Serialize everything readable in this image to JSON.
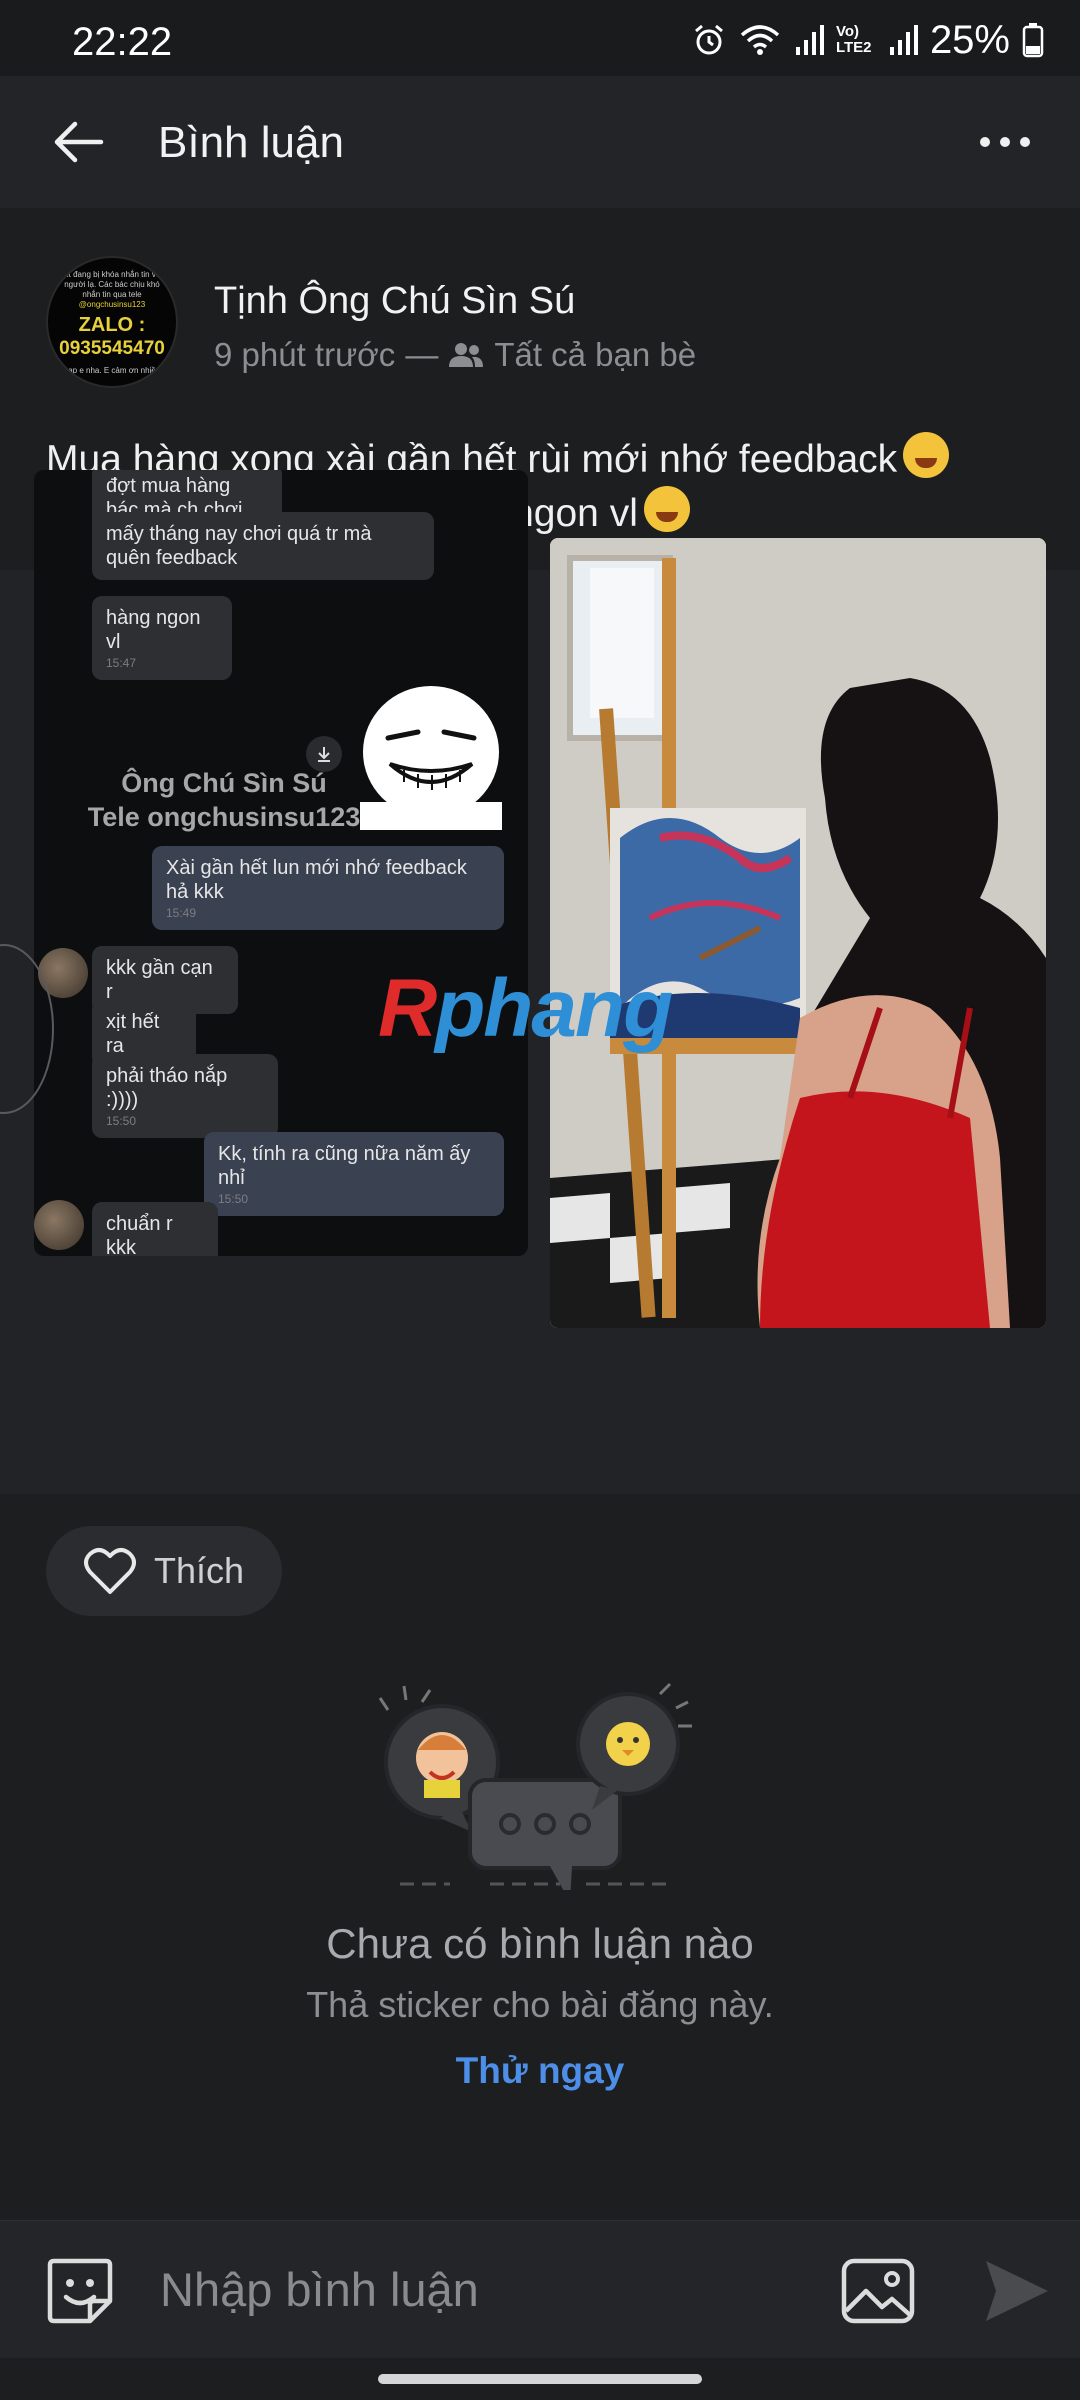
{
  "status_bar": {
    "time": "22:22",
    "network_label": "Vo) LTE2",
    "battery": "25%"
  },
  "app_bar": {
    "title": "Bình luận",
    "back_icon": "arrow-left-icon",
    "more_icon": "more-horizontal-icon"
  },
  "post": {
    "author": "Tịnh Ông Chú Sìn Sú",
    "time_ago": "9 phút trước",
    "separator": "—",
    "privacy": "Tất cả bạn bè",
    "text_line1": "Mua hàng xong xài gần hết rùi mới nhớ feedback",
    "text_line2": "Tóm lại là khách kêu hàng ngon vl",
    "avatar_text": {
      "tiny1": "Nit đang bị khóa nhắn tin với người lạ. Các bác chịu khó nhắn tin qua tele",
      "tiny2": "@ongchusinsu123",
      "zalo": "ZALO :",
      "phone": "0935545470",
      "tiny3": "nạp e nha. E cảm ơn nhiều"
    }
  },
  "chat_screenshot": {
    "messages": [
      {
        "text": "đợt mua hàng bác mà ch chơi đc",
        "time": ""
      },
      {
        "text": "mấy tháng nay chơi quá tr mà quên feedback",
        "time": ""
      },
      {
        "text": "hàng ngon vl",
        "time": "15:47"
      },
      {
        "text": "Xài gần hết lun mới nhớ feedback hả kkk",
        "time": "15:49"
      },
      {
        "text": "kkk gần cạn r",
        "time": ""
      },
      {
        "text": "xịt hết ra",
        "time": ""
      },
      {
        "text": "phải tháo nắp :))))",
        "time": "15:50"
      },
      {
        "text": "Kk, tính ra cũng nữa năm ấy nhỉ",
        "time": "15:50"
      },
      {
        "text": "chuẩn r kkk",
        "time": ""
      }
    ],
    "watermark_line1": "Ông Chú Sìn Sú",
    "watermark_line2": "Tele ongchusinsu123"
  },
  "overlay_watermark": {
    "first": "R",
    "rest": "phang"
  },
  "actions": {
    "like_label": "Thích"
  },
  "empty_state": {
    "title": "Chưa có bình luận nào",
    "subtitle": "Thả sticker cho bài đăng này.",
    "cta": "Thử ngay"
  },
  "comment_bar": {
    "placeholder": "Nhập bình luận"
  },
  "colors": {
    "background": "#1d1e20",
    "link": "#4d8fe8",
    "avatar_text": "#e7d13b"
  }
}
